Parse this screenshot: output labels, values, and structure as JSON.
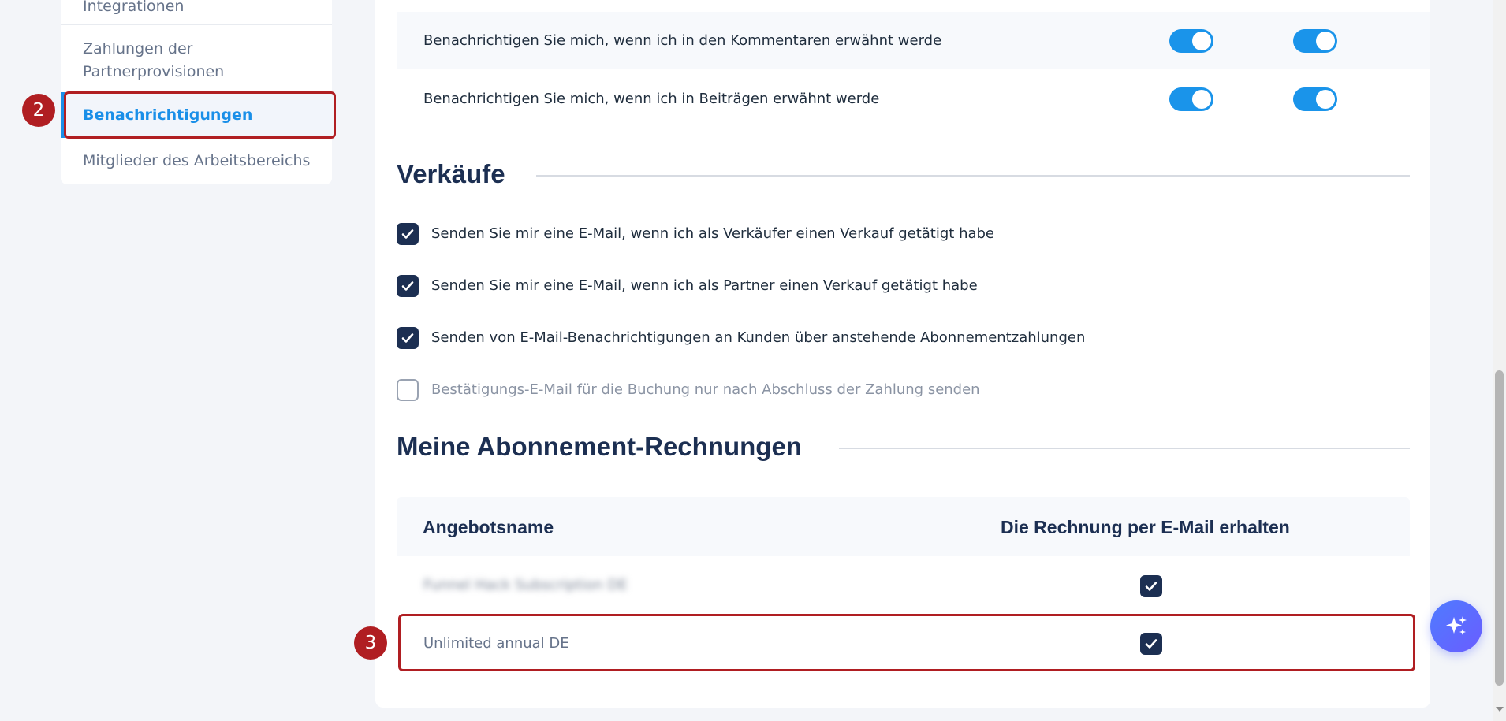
{
  "sidebar": {
    "items": [
      {
        "label": "Integrationen"
      },
      {
        "label": "Zahlungen der Partnerprovisionen"
      },
      {
        "label": "Benachrichtigungen"
      },
      {
        "label": "Mitglieder des Arbeitsbereichs"
      }
    ]
  },
  "steps": {
    "step2": "2",
    "step3": "3"
  },
  "notifications": {
    "rows": [
      {
        "label": "Benachrichtigen Sie mich, wenn ich in den Kommentaren erwähnt werde",
        "email_on": true,
        "app_on": true
      },
      {
        "label": "Benachrichtigen Sie mich, wenn ich in Beiträgen erwähnt werde",
        "email_on": true,
        "app_on": true
      }
    ]
  },
  "sales": {
    "title": "Verkäufe",
    "options": [
      {
        "label": "Senden Sie mir eine E-Mail, wenn ich als Verkäufer einen Verkauf getätigt habe",
        "checked": true
      },
      {
        "label": "Senden Sie mir eine E-Mail, wenn ich als Partner einen Verkauf getätigt habe",
        "checked": true
      },
      {
        "label": "Senden von E-Mail-Benachrichtigungen an Kunden über anstehende Abonnementzahlungen",
        "checked": true
      },
      {
        "label": "Bestätigungs-E-Mail für die Buchung nur nach Abschluss der Zahlung senden",
        "checked": false
      }
    ]
  },
  "invoices": {
    "title": "Meine Abonnement-Rechnungen",
    "columns": [
      "Angebotsname",
      "Die Rechnung per E-Mail erhalten"
    ],
    "rows": [
      {
        "name": "Funnel Hack Subscription DE",
        "checked": true
      },
      {
        "name": "Unlimited annual DE",
        "checked": true
      }
    ]
  },
  "icons": {
    "fab": "sparkle-icon",
    "check": "checkmark-icon"
  },
  "colors": {
    "accent": "#1a94ea",
    "navy": "#1c2f52",
    "highlight": "#b01e22"
  }
}
